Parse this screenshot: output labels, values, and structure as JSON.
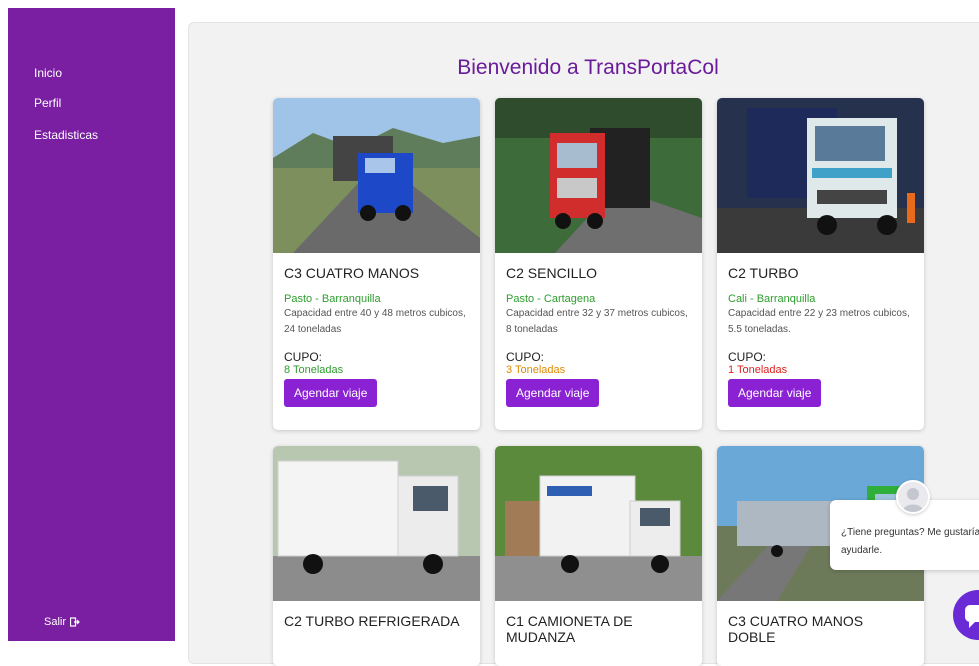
{
  "sidebar": {
    "items": [
      {
        "label": "Inicio"
      },
      {
        "label": "Perfil"
      },
      {
        "label": "Estadisticas"
      }
    ],
    "logout_label": "Salir"
  },
  "main": {
    "welcome": "Bienvenido a TransPortaCol",
    "cards": [
      {
        "title": "C3 CUATRO MANOS",
        "route": "Pasto - Barranquilla",
        "capacity": "Capacidad entre 40 y 48 metros cubicos, 24 toneladas",
        "cupo_label": "CUPO:",
        "cupo_value": "8 Toneladas",
        "cupo_color": "#2e9e2e",
        "button": "Agendar viaje"
      },
      {
        "title": "C2 SENCILLO",
        "route": "Pasto - Cartagena",
        "capacity": "Capacidad entre 32 y 37 metros cubicos, 8 toneladas",
        "cupo_label": "CUPO:",
        "cupo_value": "3 Toneladas",
        "cupo_color": "#e08a00",
        "button": "Agendar viaje"
      },
      {
        "title": "C2 TURBO",
        "route": "Cali - Barranquilla",
        "capacity": "Capacidad entre 22 y 23 metros cubicos, 5.5 toneladas.",
        "cupo_label": "CUPO:",
        "cupo_value": "1 Toneladas",
        "cupo_color": "#e02020",
        "button": "Agendar viaje"
      },
      {
        "title": "C2 TURBO REFRIGERADA"
      },
      {
        "title": "C1 CAMIONETA DE MUDANZA"
      },
      {
        "title": "C3 CUATRO MANOS DOBLE"
      }
    ]
  },
  "chat": {
    "message": "¿Tiene preguntas? Me gustaría ayudarle."
  },
  "colors": {
    "sidebar": "#7a1fa2",
    "accent": "#8a22d4",
    "heading": "#6a1b9a"
  }
}
